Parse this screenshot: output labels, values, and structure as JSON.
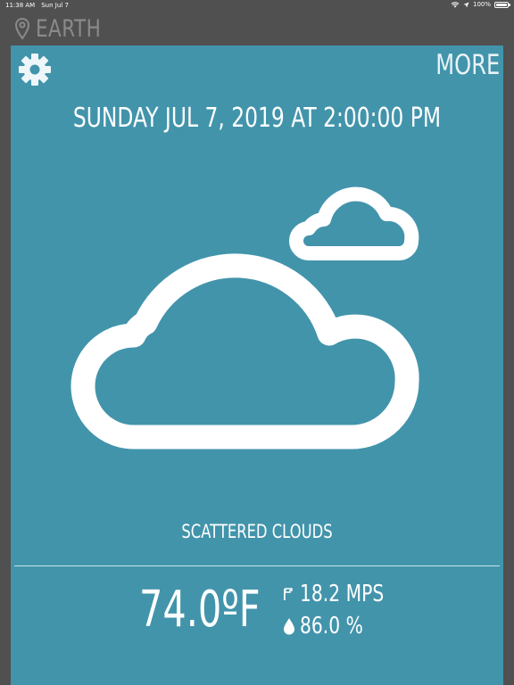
{
  "status_bar": {
    "time": "11:38 AM",
    "date": "Sun Jul 7",
    "battery": "100%"
  },
  "location": {
    "icon": "location-pin-icon",
    "name": "EARTH"
  },
  "header": {
    "settings_icon": "gear-icon",
    "more_label": "MORE"
  },
  "forecast": {
    "datetime": "SUNDAY JUL 7, 2019 AT 2:00:00 PM",
    "condition_icon": "scattered-clouds-icon",
    "description": "SCATTERED CLOUDS",
    "temperature": "74.0ºF",
    "wind": {
      "icon": "wind-flag-icon",
      "value": "18.2 MPS"
    },
    "humidity": {
      "icon": "water-drop-icon",
      "value": "86.0 %"
    }
  },
  "colors": {
    "background": "#505050",
    "card": "#4294ab",
    "text": "#ffffff",
    "muted": "#8a8a8a"
  }
}
